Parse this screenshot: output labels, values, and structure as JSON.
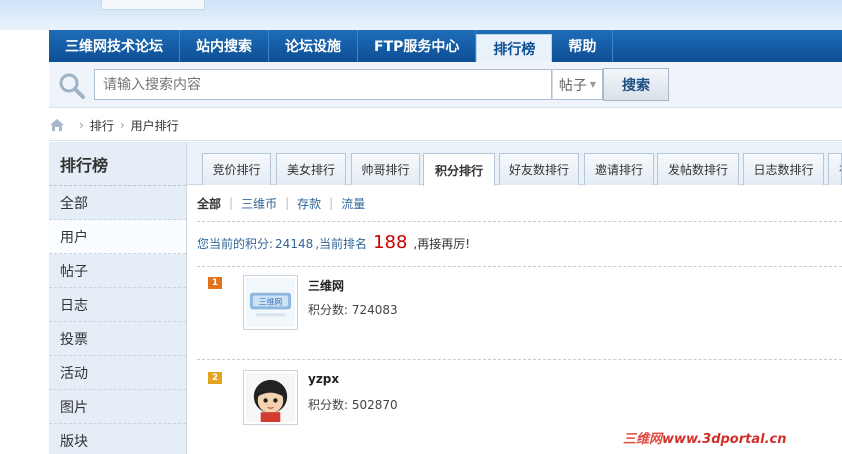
{
  "nav": {
    "items": [
      {
        "label": "三维网技术论坛",
        "active": false
      },
      {
        "label": "站内搜索",
        "active": false
      },
      {
        "label": "论坛设施",
        "active": false
      },
      {
        "label": "FTP服务中心",
        "active": false
      },
      {
        "label": "排行榜",
        "active": true
      },
      {
        "label": "帮助",
        "active": false
      }
    ]
  },
  "search": {
    "placeholder": "请输入搜索内容",
    "scope": "帖子",
    "button_label": "搜索",
    "icon": "search-icon"
  },
  "breadcrumb": {
    "home_icon": "home-icon",
    "items": [
      "排行",
      "用户排行"
    ]
  },
  "sidebar": {
    "title": "排行榜",
    "items": [
      {
        "label": "全部",
        "active": false
      },
      {
        "label": "用户",
        "active": true
      },
      {
        "label": "帖子",
        "active": false
      },
      {
        "label": "日志",
        "active": false
      },
      {
        "label": "投票",
        "active": false
      },
      {
        "label": "活动",
        "active": false
      },
      {
        "label": "图片",
        "active": false
      },
      {
        "label": "版块",
        "active": false
      }
    ]
  },
  "tabs": [
    {
      "label": "竞价排行",
      "active": false
    },
    {
      "label": "美女排行",
      "active": false
    },
    {
      "label": "帅哥排行",
      "active": false
    },
    {
      "label": "积分排行",
      "active": true
    },
    {
      "label": "好友数排行",
      "active": false
    },
    {
      "label": "邀请排行",
      "active": false
    },
    {
      "label": "发帖数排行",
      "active": false
    },
    {
      "label": "日志数排行",
      "active": false
    },
    {
      "label": "在",
      "active": false
    }
  ],
  "filters": {
    "items": [
      {
        "label": "全部",
        "current": true
      },
      {
        "label": "三维币",
        "current": false
      },
      {
        "label": "存款",
        "current": false
      },
      {
        "label": "流量",
        "current": false
      }
    ]
  },
  "my_score": {
    "prefix": "您当前的积分:",
    "score": "24148",
    "middle": ",当前排名",
    "rank": "188",
    "suffix": ",再接再厉!"
  },
  "ranking": [
    {
      "rank": "1",
      "name": "三维网",
      "score_label": "积分数:",
      "score": "724083",
      "badge_color": "#e3741f",
      "avatar_text": "三维网"
    },
    {
      "rank": "2",
      "name": "yzpx",
      "score_label": "积分数:",
      "score": "502870",
      "badge_color": "#e6a321"
    }
  ],
  "watermark": {
    "cn": "三维网",
    "url": "www.3dportal.cn"
  }
}
